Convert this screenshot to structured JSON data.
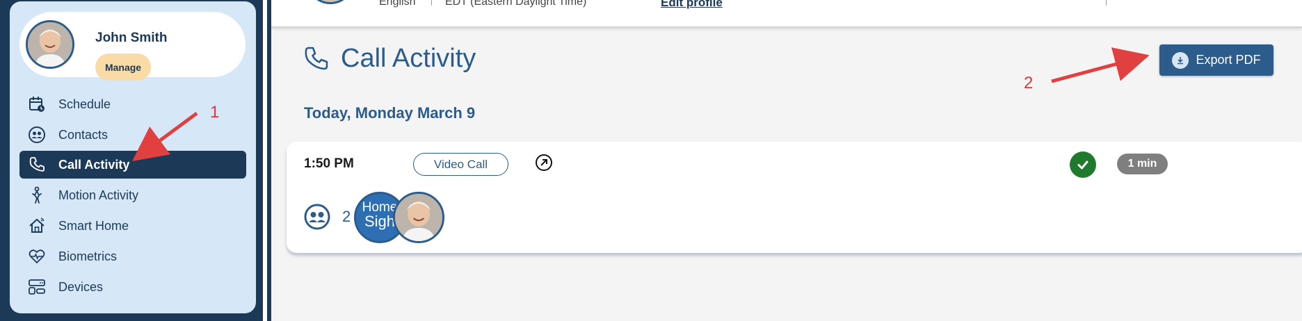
{
  "profile": {
    "name": "John Smith",
    "manage_label": "Manage"
  },
  "sidebar": {
    "items": [
      {
        "label": "Schedule",
        "icon": "calendar-clock-icon",
        "active": false
      },
      {
        "label": "Contacts",
        "icon": "contacts-icon",
        "active": false
      },
      {
        "label": "Call Activity",
        "icon": "phone-icon",
        "active": true
      },
      {
        "label": "Motion Activity",
        "icon": "motion-icon",
        "active": false
      },
      {
        "label": "Smart Home",
        "icon": "smart-home-icon",
        "active": false
      },
      {
        "label": "Biometrics",
        "icon": "heart-pulse-icon",
        "active": false
      },
      {
        "label": "Devices",
        "icon": "devices-icon",
        "active": false
      }
    ]
  },
  "top_bar": {
    "language": "English",
    "timezone": "EDT (Eastern Daylight Time)",
    "edit_profile_label": "Edit profile"
  },
  "page": {
    "title": "Call Activity",
    "export_label": "Export PDF",
    "date_heading": "Today, Monday March 9"
  },
  "calls": [
    {
      "time": "1:50 PM",
      "type": "Video Call",
      "direction_icon": "outgoing-arrow-icon",
      "status_icon": "check-circle-icon",
      "duration": "1 min",
      "participant_count": "2",
      "participants": [
        {
          "kind": "logo",
          "logo_text_1": "Home",
          "logo_text_2": "Sigh"
        },
        {
          "kind": "photo"
        }
      ]
    }
  ],
  "annotations": {
    "marker_1": "1",
    "marker_2": "2"
  },
  "colors": {
    "brand_dark": "#1c3a58",
    "brand_blue": "#2b5c8c",
    "sidebar_bg": "#d6e8f8",
    "manage_bg": "#f9dba5",
    "success": "#1f7a2e",
    "annotation_red": "#d63a3a"
  }
}
